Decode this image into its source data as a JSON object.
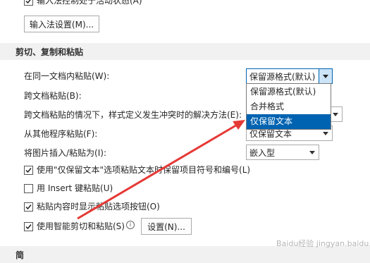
{
  "top": {
    "ime_active_label": "输入法控制处于活动状态(A)",
    "ime_settings_button": "输入法设置(M)..."
  },
  "section_cut_copy_paste": {
    "title": "剪切、复制和粘贴"
  },
  "options": {
    "within_doc_label": "在同一文档内粘贴(W):",
    "within_doc_value": "保留源格式(默认)",
    "between_docs_label": "跨文档粘贴(B):",
    "between_docs_conflict_label": "跨文档粘贴的情况下，样式定义发生冲突时的解决方法(E):",
    "from_other_programs_label": "从其他程序粘贴(F):",
    "from_other_programs_value": "仅保留文本",
    "insert_picture_label": "将图片插入/粘贴为(I):",
    "insert_picture_value": "嵌入型",
    "keep_bullets_label": "使用\"仅保留文本\"选项粘贴文本时保留项目符号和编号(L)",
    "insert_key_label": "用 Insert 键粘贴(U)",
    "show_paste_options_label": "粘贴内容时显示粘贴选项按钮(O)",
    "smart_cut_paste_label": "使用智能剪切和粘贴(S)",
    "settings_button": "设置(N)..."
  },
  "dropdown": {
    "items": [
      "保留源格式(默认)",
      "合并格式",
      "仅保留文本"
    ],
    "selected_index": 2
  },
  "checkboxes": {
    "ime_active": true,
    "keep_bullets": true,
    "insert_key": false,
    "show_paste_options": true,
    "smart_cut_paste": true
  },
  "next_section": {
    "title": "简"
  },
  "watermark": "Baidu经验 jingyan.baidu.com",
  "colors": {
    "accent": "#0063b1",
    "arrow": "#e53935",
    "section_bg": "#f1f1f1"
  }
}
